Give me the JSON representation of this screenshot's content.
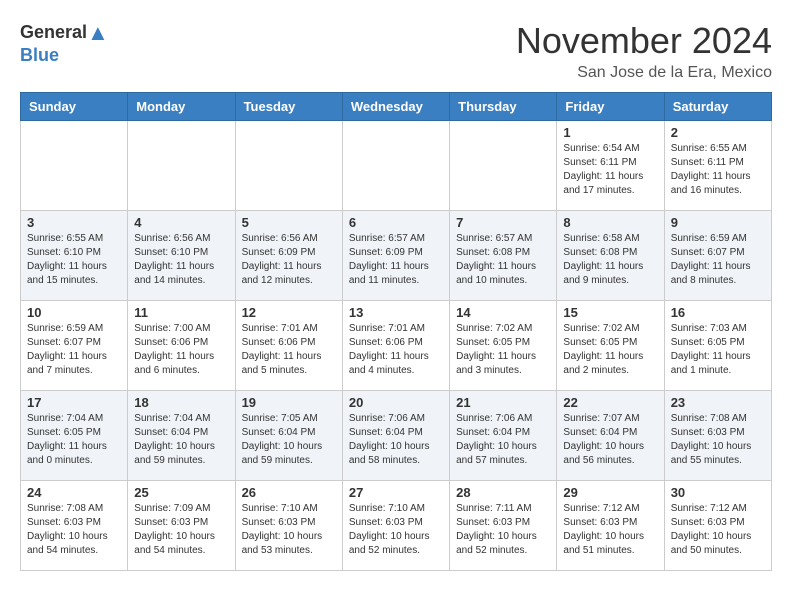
{
  "header": {
    "logo_general": "General",
    "logo_blue": "Blue",
    "month_title": "November 2024",
    "location": "San Jose de la Era, Mexico"
  },
  "weekdays": [
    "Sunday",
    "Monday",
    "Tuesday",
    "Wednesday",
    "Thursday",
    "Friday",
    "Saturday"
  ],
  "weeks": [
    [
      {
        "day": "",
        "info": ""
      },
      {
        "day": "",
        "info": ""
      },
      {
        "day": "",
        "info": ""
      },
      {
        "day": "",
        "info": ""
      },
      {
        "day": "",
        "info": ""
      },
      {
        "day": "1",
        "info": "Sunrise: 6:54 AM\nSunset: 6:11 PM\nDaylight: 11 hours and 17 minutes."
      },
      {
        "day": "2",
        "info": "Sunrise: 6:55 AM\nSunset: 6:11 PM\nDaylight: 11 hours and 16 minutes."
      }
    ],
    [
      {
        "day": "3",
        "info": "Sunrise: 6:55 AM\nSunset: 6:10 PM\nDaylight: 11 hours and 15 minutes."
      },
      {
        "day": "4",
        "info": "Sunrise: 6:56 AM\nSunset: 6:10 PM\nDaylight: 11 hours and 14 minutes."
      },
      {
        "day": "5",
        "info": "Sunrise: 6:56 AM\nSunset: 6:09 PM\nDaylight: 11 hours and 12 minutes."
      },
      {
        "day": "6",
        "info": "Sunrise: 6:57 AM\nSunset: 6:09 PM\nDaylight: 11 hours and 11 minutes."
      },
      {
        "day": "7",
        "info": "Sunrise: 6:57 AM\nSunset: 6:08 PM\nDaylight: 11 hours and 10 minutes."
      },
      {
        "day": "8",
        "info": "Sunrise: 6:58 AM\nSunset: 6:08 PM\nDaylight: 11 hours and 9 minutes."
      },
      {
        "day": "9",
        "info": "Sunrise: 6:59 AM\nSunset: 6:07 PM\nDaylight: 11 hours and 8 minutes."
      }
    ],
    [
      {
        "day": "10",
        "info": "Sunrise: 6:59 AM\nSunset: 6:07 PM\nDaylight: 11 hours and 7 minutes."
      },
      {
        "day": "11",
        "info": "Sunrise: 7:00 AM\nSunset: 6:06 PM\nDaylight: 11 hours and 6 minutes."
      },
      {
        "day": "12",
        "info": "Sunrise: 7:01 AM\nSunset: 6:06 PM\nDaylight: 11 hours and 5 minutes."
      },
      {
        "day": "13",
        "info": "Sunrise: 7:01 AM\nSunset: 6:06 PM\nDaylight: 11 hours and 4 minutes."
      },
      {
        "day": "14",
        "info": "Sunrise: 7:02 AM\nSunset: 6:05 PM\nDaylight: 11 hours and 3 minutes."
      },
      {
        "day": "15",
        "info": "Sunrise: 7:02 AM\nSunset: 6:05 PM\nDaylight: 11 hours and 2 minutes."
      },
      {
        "day": "16",
        "info": "Sunrise: 7:03 AM\nSunset: 6:05 PM\nDaylight: 11 hours and 1 minute."
      }
    ],
    [
      {
        "day": "17",
        "info": "Sunrise: 7:04 AM\nSunset: 6:05 PM\nDaylight: 11 hours and 0 minutes."
      },
      {
        "day": "18",
        "info": "Sunrise: 7:04 AM\nSunset: 6:04 PM\nDaylight: 10 hours and 59 minutes."
      },
      {
        "day": "19",
        "info": "Sunrise: 7:05 AM\nSunset: 6:04 PM\nDaylight: 10 hours and 59 minutes."
      },
      {
        "day": "20",
        "info": "Sunrise: 7:06 AM\nSunset: 6:04 PM\nDaylight: 10 hours and 58 minutes."
      },
      {
        "day": "21",
        "info": "Sunrise: 7:06 AM\nSunset: 6:04 PM\nDaylight: 10 hours and 57 minutes."
      },
      {
        "day": "22",
        "info": "Sunrise: 7:07 AM\nSunset: 6:04 PM\nDaylight: 10 hours and 56 minutes."
      },
      {
        "day": "23",
        "info": "Sunrise: 7:08 AM\nSunset: 6:03 PM\nDaylight: 10 hours and 55 minutes."
      }
    ],
    [
      {
        "day": "24",
        "info": "Sunrise: 7:08 AM\nSunset: 6:03 PM\nDaylight: 10 hours and 54 minutes."
      },
      {
        "day": "25",
        "info": "Sunrise: 7:09 AM\nSunset: 6:03 PM\nDaylight: 10 hours and 54 minutes."
      },
      {
        "day": "26",
        "info": "Sunrise: 7:10 AM\nSunset: 6:03 PM\nDaylight: 10 hours and 53 minutes."
      },
      {
        "day": "27",
        "info": "Sunrise: 7:10 AM\nSunset: 6:03 PM\nDaylight: 10 hours and 52 minutes."
      },
      {
        "day": "28",
        "info": "Sunrise: 7:11 AM\nSunset: 6:03 PM\nDaylight: 10 hours and 52 minutes."
      },
      {
        "day": "29",
        "info": "Sunrise: 7:12 AM\nSunset: 6:03 PM\nDaylight: 10 hours and 51 minutes."
      },
      {
        "day": "30",
        "info": "Sunrise: 7:12 AM\nSunset: 6:03 PM\nDaylight: 10 hours and 50 minutes."
      }
    ]
  ]
}
